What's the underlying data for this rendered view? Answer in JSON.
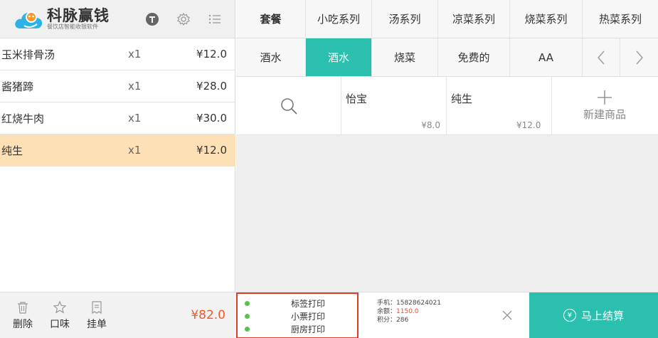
{
  "brand": {
    "title": "科脉赢钱",
    "subtitle": "餐饮店智能收银软件"
  },
  "top_icons": [
    "membership-icon",
    "gear-icon",
    "list-icon"
  ],
  "orders": [
    {
      "name": "玉米排骨汤",
      "qty": "x1",
      "price": "¥12.0",
      "selected": false
    },
    {
      "name": "酱猪蹄",
      "qty": "x1",
      "price": "¥28.0",
      "selected": false
    },
    {
      "name": "红烧牛肉",
      "qty": "x1",
      "price": "¥30.0",
      "selected": false
    },
    {
      "name": "纯生",
      "qty": "x1",
      "price": "¥12.0",
      "selected": true
    }
  ],
  "footer": {
    "delete_label": "删除",
    "flavor_label": "口味",
    "hold_label": "挂单",
    "total": "¥82.0"
  },
  "categories_row1": [
    "套餐",
    "小吃系列",
    "汤系列",
    "凉菜系列",
    "烧菜系列",
    "热菜系列"
  ],
  "categories_row2": [
    "酒水",
    "酒水",
    "烧菜",
    "免费的",
    "AA"
  ],
  "active_category": "酒水",
  "products": [
    {
      "name": "怡宝",
      "price": "¥8.0"
    },
    {
      "name": "纯生",
      "price": "¥12.0"
    }
  ],
  "new_product_label": "新建商品",
  "print": {
    "label_print": "标签打印",
    "receipt_print": "小票打印",
    "kitchen_print": "厨房打印"
  },
  "member": {
    "phone": "手机：15828624021",
    "balance_label": "余额：",
    "balance": "1150.0",
    "points": "积分：286"
  },
  "checkout_label": "马上结算",
  "colors": {
    "accent": "#2bbfae",
    "price_red": "#ee5a2a",
    "selected_row": "#fde0b6",
    "print_border": "#e13b2e",
    "status_green": "#54c54a"
  }
}
